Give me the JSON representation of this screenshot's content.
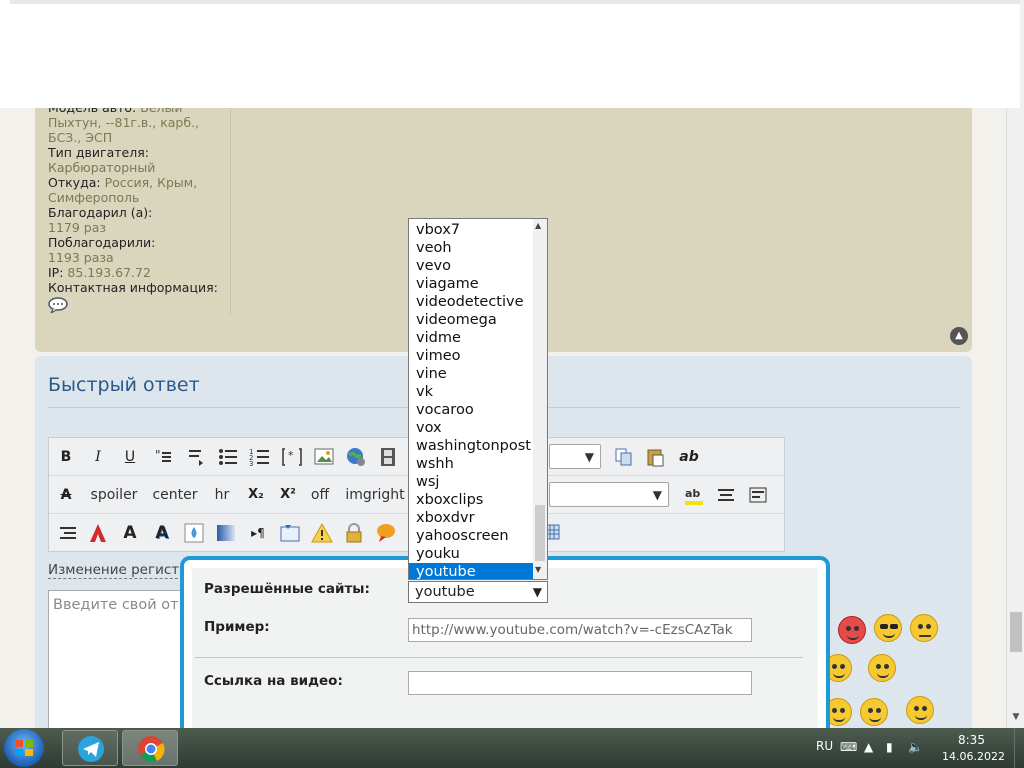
{
  "post": {
    "info": [
      {
        "label": "Модель авто:",
        "value": "Белый"
      },
      {
        "label": "",
        "value": "Пыхтун, --81г.в., карб.,"
      },
      {
        "label": "",
        "value": "БСЗ., ЭСП"
      },
      {
        "label": "Тип двигателя:",
        "value": ""
      },
      {
        "label": "",
        "value": "Карбюраторный"
      },
      {
        "label": "Откуда:",
        "value": "Россия, Крым,"
      },
      {
        "label": "",
        "value": "Симферополь"
      },
      {
        "label": "Благодарил (а):",
        "value": ""
      },
      {
        "label": "",
        "value": "1179 раз"
      },
      {
        "label": "Поблагодарили:",
        "value": ""
      },
      {
        "label": "",
        "value": "1193 раза"
      },
      {
        "label": "IP:",
        "value": "85.193.67.72"
      },
      {
        "label": "Контактная информация:",
        "value": ""
      }
    ],
    "contact_icon": "speech-bubble-icon"
  },
  "reply": {
    "title": "Быстрый ответ",
    "case_link": "Изменение регистр",
    "message_placeholder": "Введите свой отв"
  },
  "toolbar": {
    "row1": [
      "B",
      "I",
      "U"
    ],
    "row2_text": [
      "spoiler",
      "center",
      "hr",
      "off",
      "imgright"
    ],
    "sub": "X₂",
    "sup": "X²",
    "ab": "ab"
  },
  "video_dialog": {
    "sites_label": "Разрешённые сайты:",
    "sites_value": "youtube",
    "example_label": "Пример:",
    "example_value": "http://www.youtube.com/watch?v=-cEzsCAzTak",
    "link_label": "Ссылка на видео:",
    "link_value": ""
  },
  "dropdown": {
    "items": [
      "vbox7",
      "veoh",
      "vevo",
      "viagame",
      "videodetective",
      "videomega",
      "vidme",
      "vimeo",
      "vine",
      "vk",
      "vocaroo",
      "vox",
      "washingtonpost",
      "wshh",
      "wsj",
      "xboxclips",
      "xboxdvr",
      "yahooscreen",
      "youku",
      "youtube"
    ],
    "selected": "youtube"
  },
  "taskbar": {
    "lang": "RU",
    "time": "8:35",
    "date": "14.06.2022",
    "apps": [
      "telegram-icon",
      "chrome-icon"
    ]
  },
  "colors": {
    "post_panel": "#dad6bd",
    "reply_panel": "#dde6ec",
    "dialog_border": "#1f9ad6",
    "selection": "#0078d7",
    "title": "#2a5a8a"
  }
}
